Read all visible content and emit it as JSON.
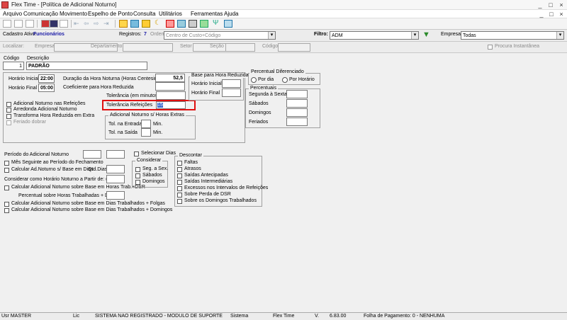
{
  "window": {
    "title": "Flex Time - [Política de Adicional Noturno]",
    "controls": [
      "_",
      "□",
      "×"
    ],
    "inner_controls": [
      "_",
      "□",
      "×"
    ]
  },
  "menu": [
    "Arquivo",
    "Comunicação",
    "Movimento",
    "Espelho de Ponto",
    "Consulta",
    "Utilitários",
    "Ferramentas",
    "Ajuda"
  ],
  "filterbar": {
    "cadastro_label": "Cadastro Ativo:",
    "cadastro_value": "Funcionários",
    "registros_label": "Registros:",
    "registros_value": "7",
    "ordem_label": "Ordem:",
    "ordem_value": "Centro de Custo+Código",
    "filtro_label": "Filtro:",
    "filtro_value": "ADM",
    "empresa_label": "Empresa:",
    "empresa_value": "Todas"
  },
  "findbar": {
    "localizar": "Localizar:",
    "empresa": "Empresa",
    "departamento": "Departamento",
    "setor": "Setor",
    "secao": "Seção",
    "codigo": "Código",
    "procura": "Procura Instantânea"
  },
  "form": {
    "codigo_label": "Código",
    "codigo_value": "1",
    "descricao_label": "Descrição",
    "descricao_value": "PADRÃO",
    "horario_inicial_label": "Horário Inicial",
    "horario_inicial_value": "22:00",
    "horario_final_label": "Horário Final",
    "horario_final_value": "05:00",
    "duracao_label": "Duração da Hora Noturna (Horas Centesimais)",
    "duracao_value": "52,5",
    "coeficiente_label": "Coeficiente para Hora Reduzida",
    "tolerancia_min_label": "Tolerância (em minutos)",
    "tolerancia_ref_label": "Tolerância Refeições",
    "tolerancia_ref_value": "15",
    "checks_left": [
      "Adicional Noturno nas Refeições",
      "Arredonda Adicional Noturno",
      "Transforma Hora Reduzida em Extra",
      "Feriado dobrar"
    ],
    "base_group": {
      "title": "Base para Hora Reduzida",
      "hi": "Horário Inicial",
      "hf": "Horário Final"
    },
    "extras_group": {
      "title": "Adicional Noturno s/ Horas Extras",
      "entrada": "Tol. na Entrada",
      "saida": "Tol. na Saída",
      "min": "Min."
    },
    "percentual_dif": {
      "title": "Percentual Diferenciado",
      "por_dia": "Por dia",
      "por_horario": "Por Horário"
    },
    "percentuais": {
      "title": "Percentuais",
      "items": [
        "Segunda à Sexta",
        "Sábados",
        "Domingos",
        "Feriados"
      ]
    }
  },
  "lower": {
    "periodo_label": "Período do Adicional Noturno",
    "selecionar_dias": "Selecionar Dias",
    "mes_seguinte": "Mês Seguinte ao Período do Fechamento",
    "calcular_base_dias": "Calcular Ad.Noturno s/ Base em Dias",
    "qtd_dias": "Qtd.Dias",
    "considerar_label": "Considerar como Horário Noturno a Partir de: (dias)",
    "calc_trab_dsr": "Calcular Adicional Noturno sobre Base em Horas Trab.+DSR",
    "percentual_trab": "Percentual sobre Horas Trabalhadas + DSR",
    "calc_folgas": "Calcular Adicional Noturno sobre Base em Dias Trabalhados + Folgas",
    "calc_domingos": "Calcular Adicional Noturno sobre Base em Dias Trabalhados + Domingos",
    "considerar_group": {
      "title": "Considerar",
      "items": [
        "Seg. a Sex.",
        "Sábados",
        "Domingos"
      ]
    },
    "descontar_group": {
      "title": "Descontar",
      "items": [
        "Faltas",
        "Atrasos",
        "Saídas Antecipadas",
        "Saídas Intermediárias",
        "Excessos nos Intervalos de Refeições",
        "Sobre Perda de DSR",
        "Sobre os Domingos Trabalhados"
      ]
    }
  },
  "status": {
    "usr": "Usr MASTER",
    "lic": "Lic",
    "sistema_msg": "SISTEMA NAO REGISTRADO - MODULO DE SUPORTE",
    "sistema": "Sistema",
    "app": "Flex Time",
    "v": "V.",
    "version": "6.83.00",
    "folha": "Folha de Pagamento: 0 - NENHUMA"
  }
}
